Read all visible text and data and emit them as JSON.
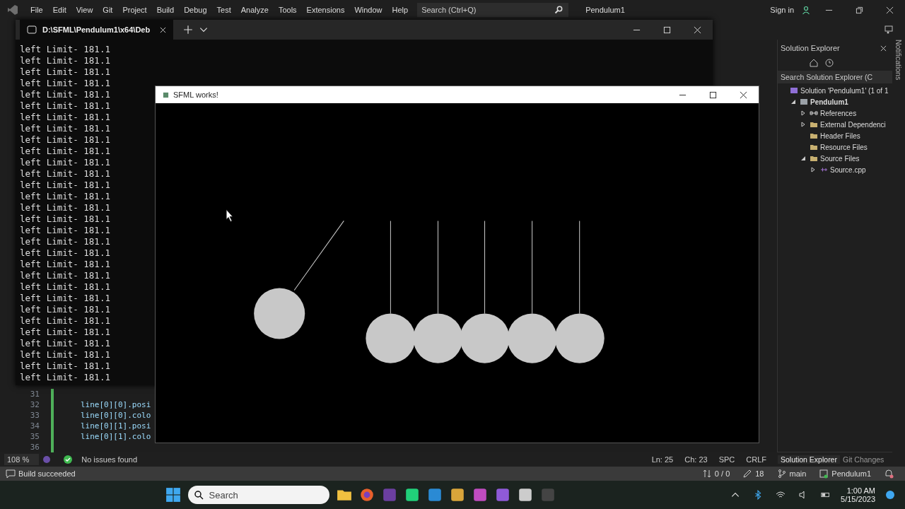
{
  "ide": {
    "menu": [
      "File",
      "Edit",
      "View",
      "Git",
      "Project",
      "Build",
      "Debug",
      "Test",
      "Analyze",
      "Tools",
      "Extensions",
      "Window",
      "Help"
    ],
    "search": {
      "placeholder": "Search (Ctrl+Q)"
    },
    "solution_name": "Pendulum1",
    "sign_in": "Sign in",
    "notifications_label": "Notifications"
  },
  "console": {
    "tab_title": "D:\\SFML\\Pendulum1\\x64\\Deb",
    "lines": [
      "left Limit- 181.1",
      "left Limit- 181.1",
      "left Limit- 181.1",
      "left Limit- 181.1",
      "left Limit- 181.1",
      "left Limit- 181.1",
      "left Limit- 181.1",
      "left Limit- 181.1",
      "left Limit- 181.1",
      "left Limit- 181.1",
      "left Limit- 181.1",
      "left Limit- 181.1",
      "left Limit- 181.1",
      "left Limit- 181.1",
      "left Limit- 181.1",
      "left Limit- 181.1",
      "left Limit- 181.1",
      "left Limit- 181.1",
      "left Limit- 181.1",
      "left Limit- 181.1",
      "left Limit- 181.1",
      "left Limit- 181.1",
      "left Limit- 181.1",
      "left Limit- 181.1",
      "left Limit- 181.1",
      "left Limit- 181.1",
      "left Limit- 181.1",
      "left Limit- 181.1",
      "left Limit- 181.1",
      "left Limit- 181.1"
    ]
  },
  "sfml_window": {
    "title": "SFML works!"
  },
  "editor": {
    "lines": [
      {
        "number": "31"
      },
      {
        "number": "32",
        "code": "line[0][0].posi"
      },
      {
        "number": "33",
        "code": "line[0][0].colo"
      },
      {
        "number": "34",
        "code": "line[0][1].posi"
      },
      {
        "number": "35",
        "code": "line[0][1].colo"
      },
      {
        "number": "36"
      }
    ]
  },
  "editor_status": {
    "zoom": "108 %",
    "issues": "No issues found",
    "line": "Ln: 25",
    "column": "Ch: 23",
    "whitespace": "SPC",
    "line_endings": "CRLF"
  },
  "solution_explorer": {
    "title": "Solution Explorer",
    "search": {
      "placeholder": "Search Solution Explorer (C"
    },
    "tree": [
      {
        "label": "Solution 'Pendulum1' (1 of 1",
        "kind": "solution",
        "bold": false,
        "children": [
          {
            "label": "Pendulum1",
            "kind": "project",
            "bold": true,
            "expandable": true,
            "expanded": true,
            "children": [
              {
                "label": "References",
                "kind": "references",
                "bold": false,
                "expandable": true,
                "expanded": false
              },
              {
                "label": "External Dependenci",
                "kind": "external",
                "bold": false,
                "expandable": true,
                "expanded": false
              },
              {
                "label": "Header Files",
                "kind": "filter",
                "bold": false,
                "expandable": false
              },
              {
                "label": "Resource Files",
                "kind": "filter",
                "bold": false,
                "expandable": false
              },
              {
                "label": "Source Files",
                "kind": "filter",
                "bold": false,
                "expandable": true,
                "expanded": true,
                "children": [
                  {
                    "label": "Source.cpp",
                    "kind": "cpp",
                    "bold": false,
                    "expandable": true,
                    "expanded": false
                  }
                ]
              }
            ]
          }
        ]
      }
    ],
    "tabs": [
      {
        "label": "Solution Explorer",
        "selected": true
      },
      {
        "label": "Git Changes",
        "selected": false
      }
    ]
  },
  "status_bar": {
    "message": "Build succeeded",
    "sync": "0 / 0",
    "edits": "18",
    "branch": "main",
    "project": "Pendulum1"
  },
  "taskbar": {
    "search": {
      "placeholder": "Search"
    },
    "time": "1:00 AM",
    "date": "5/15/2023"
  }
}
